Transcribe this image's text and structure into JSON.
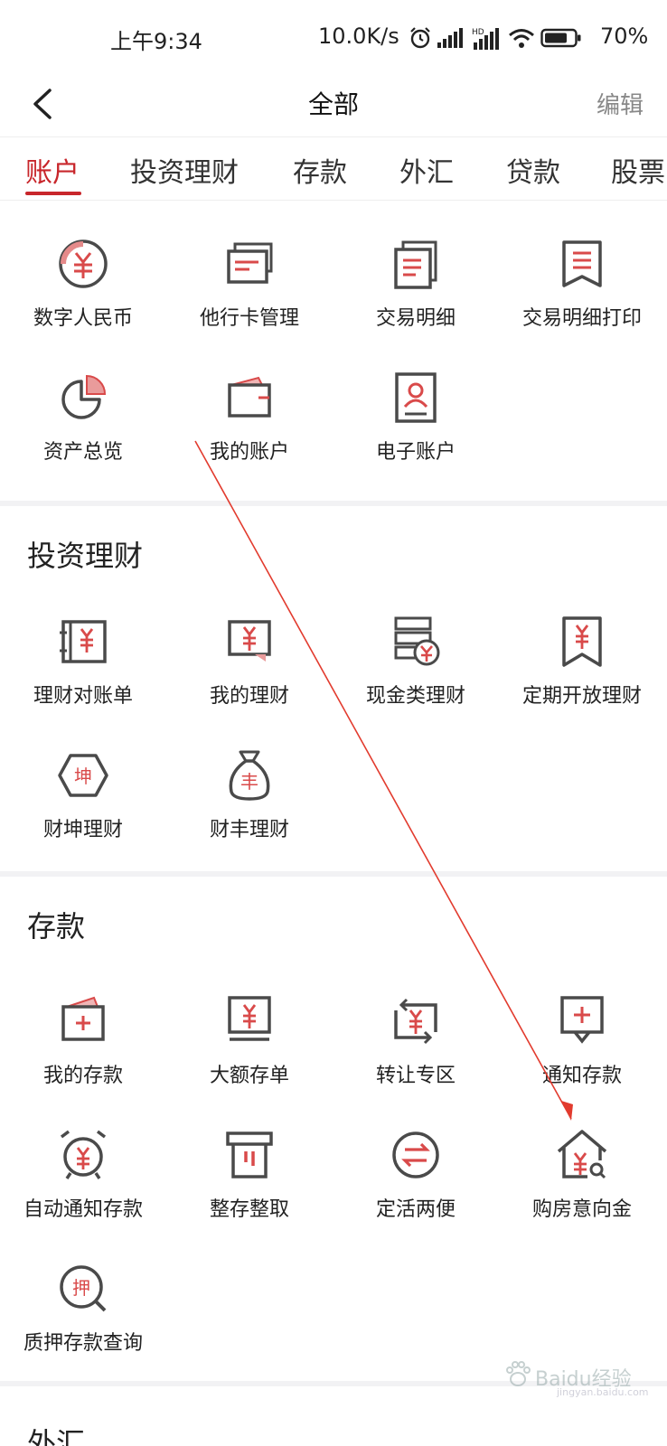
{
  "status_bar": {
    "time": "上午9:34",
    "net_speed": "10.0K/s",
    "battery": "70%",
    "icons": [
      "alarm-icon",
      "signal-icon",
      "hd-signal-icon",
      "wifi-icon",
      "battery-icon"
    ]
  },
  "nav": {
    "title": "全部",
    "edit_label": "编辑"
  },
  "tabs": [
    {
      "label": "账户",
      "active": true
    },
    {
      "label": "投资理财",
      "active": false
    },
    {
      "label": "存款",
      "active": false
    },
    {
      "label": "外汇",
      "active": false
    },
    {
      "label": "贷款",
      "active": false
    },
    {
      "label": "股票",
      "active": false
    }
  ],
  "sections": {
    "account": {
      "items": [
        {
          "label": "数字人民币",
          "icon": "digital-rmb-icon"
        },
        {
          "label": "他行卡管理",
          "icon": "cards-icon"
        },
        {
          "label": "交易明细",
          "icon": "transaction-detail-icon"
        },
        {
          "label": "交易明细打印",
          "icon": "receipt-print-icon"
        },
        {
          "label": "资产总览",
          "icon": "pie-chart-icon"
        },
        {
          "label": "我的账户",
          "icon": "wallet-icon"
        },
        {
          "label": "电子账户",
          "icon": "e-account-icon"
        }
      ]
    },
    "invest": {
      "title": "投资理财",
      "items": [
        {
          "label": "理财对账单",
          "icon": "statement-icon"
        },
        {
          "label": "我的理财",
          "icon": "my-finance-icon"
        },
        {
          "label": "现金类理财",
          "icon": "cash-finance-icon"
        },
        {
          "label": "定期开放理财",
          "icon": "fixed-open-icon"
        },
        {
          "label": "财坤理财",
          "icon": "caikun-icon"
        },
        {
          "label": "财丰理财",
          "icon": "money-bag-icon"
        }
      ]
    },
    "deposit": {
      "title": "存款",
      "items": [
        {
          "label": "我的存款",
          "icon": "my-deposit-icon"
        },
        {
          "label": "大额存单",
          "icon": "large-deposit-icon"
        },
        {
          "label": "转让专区",
          "icon": "transfer-zone-icon"
        },
        {
          "label": "通知存款",
          "icon": "notice-deposit-icon"
        },
        {
          "label": "自动通知存款",
          "icon": "alarm-clock-icon"
        },
        {
          "label": "整存整取",
          "icon": "lump-sum-icon"
        },
        {
          "label": "定活两便",
          "icon": "exchange-icon"
        },
        {
          "label": "购房意向金",
          "icon": "house-deposit-icon"
        },
        {
          "label": "质押存款查询",
          "icon": "pledge-search-icon"
        }
      ]
    },
    "forex": {
      "title": "外汇"
    }
  },
  "watermark": {
    "text": "Baidu经验",
    "sub": "jingyan.baidu.com"
  },
  "colors": {
    "accent": "#c8262b",
    "icon_gray": "#4a4a4a",
    "icon_red": "#d94a4a",
    "separator": "#f2f2f4"
  }
}
